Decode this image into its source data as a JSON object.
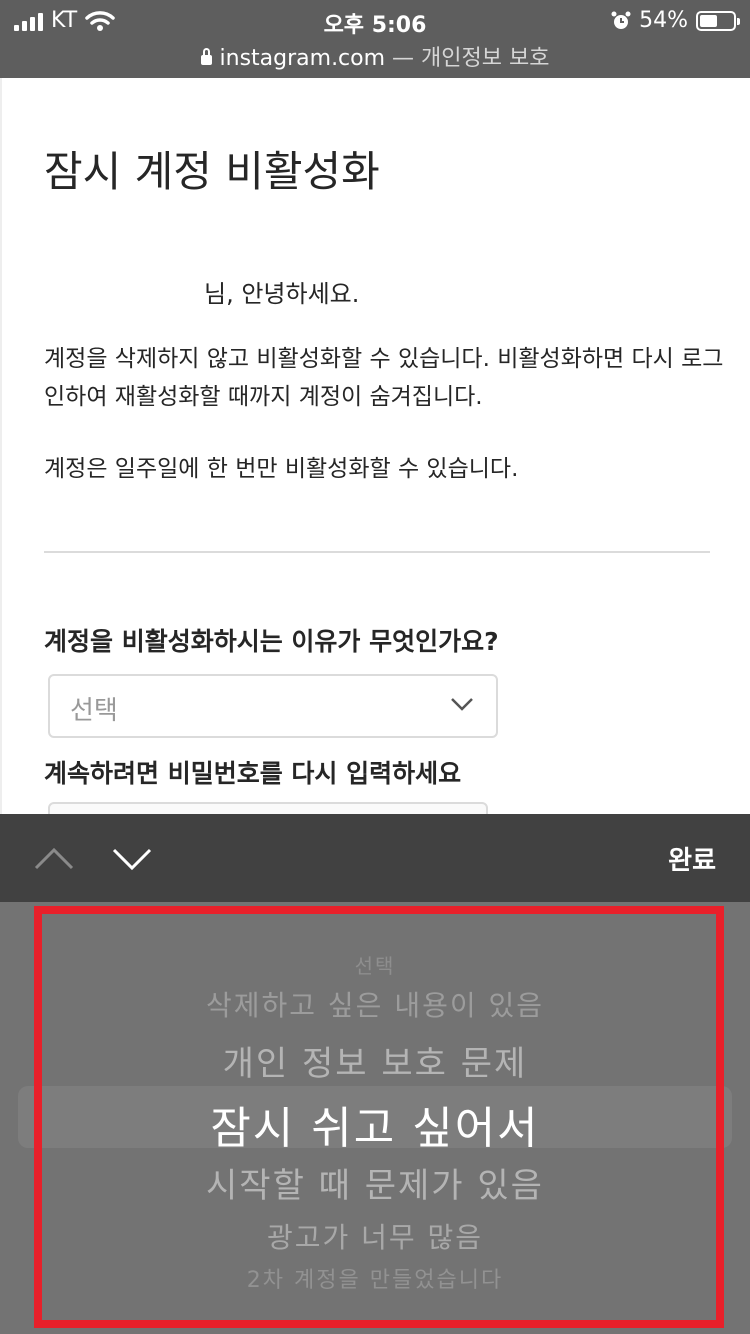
{
  "status_bar": {
    "carrier": "KT",
    "time": "오후 5:06",
    "battery": "54%",
    "battery_level": 0.54,
    "url_domain": "instagram.com",
    "url_suffix": "— 개인정보 보호"
  },
  "page": {
    "title": "잠시 계정 비활성화",
    "greeting": "님, 안녕하세요.",
    "paragraph1": "계정을 삭제하지 않고 비활성화할 수 있습니다. 비활성화하면 다시 로그인하여 재활성화할 때까지 계정이 숨겨집니다.",
    "paragraph2": "계정은 일주일에 한 번만 비활성화할 수 있습니다.",
    "reason_question": "계정을 비활성화하시는 이유가 무엇인가요?",
    "reason_select_value": "선택",
    "password_prompt": "계속하려면 비밀번호를 다시 입력하세요"
  },
  "accessory_bar": {
    "done_label": "완료"
  },
  "picker": {
    "options": [
      "선택",
      "삭제하고 싶은 내용이 있음",
      "개인 정보 보호 문제",
      "잠시 쉬고 싶어서",
      "시작할 때 문제가 있음",
      "광고가 너무 많음",
      "2차 계정을 만들었습니다"
    ],
    "selected_index": 3
  }
}
